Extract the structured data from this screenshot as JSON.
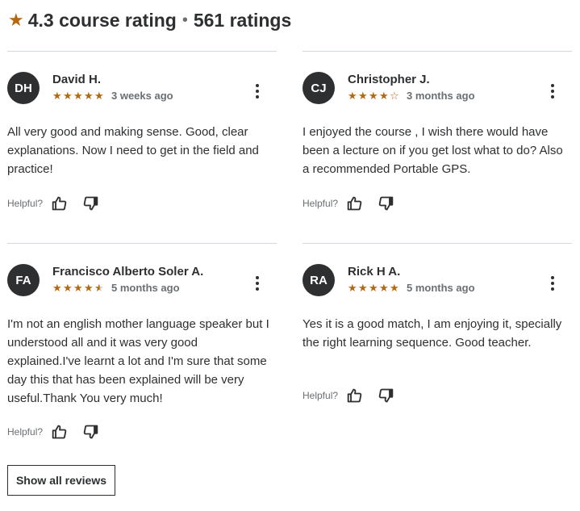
{
  "header": {
    "rating": "4.3 course rating",
    "separator": "•",
    "count": "561 ratings"
  },
  "colors": {
    "star": "#b4690e",
    "text": "#2d2f31",
    "muted": "#6a6f73",
    "divider": "#d1d7dc"
  },
  "helpful_label": "Helpful?",
  "reviews": [
    {
      "initials": "DH",
      "name": "David H.",
      "rating": 5,
      "date": "3 weeks ago",
      "text": "All very good and making sense. Good, clear explanations. Now I need to get in the field and practice!"
    },
    {
      "initials": "CJ",
      "name": "Christopher J.",
      "rating": 4,
      "date": "3 months ago",
      "text": "I enjoyed the course , I wish there would have been a lecture on if you get lost what to do? Also a recommended Portable GPS."
    },
    {
      "initials": "FA",
      "name": "Francisco Alberto Soler A.",
      "rating": 4.5,
      "date": "5 months ago",
      "text": "I'm not an english mother language speaker but I understood all and it was very good explained.I've learnt a lot and I'm sure that some day this that has been explained will be very useful.Thank You very much!"
    },
    {
      "initials": "RA",
      "name": "Rick H A.",
      "rating": 5,
      "date": "5 months ago",
      "text": "Yes it is a good match, I am enjoying it, specially the right learning sequence. Good teacher."
    }
  ],
  "show_all_label": "Show all reviews"
}
